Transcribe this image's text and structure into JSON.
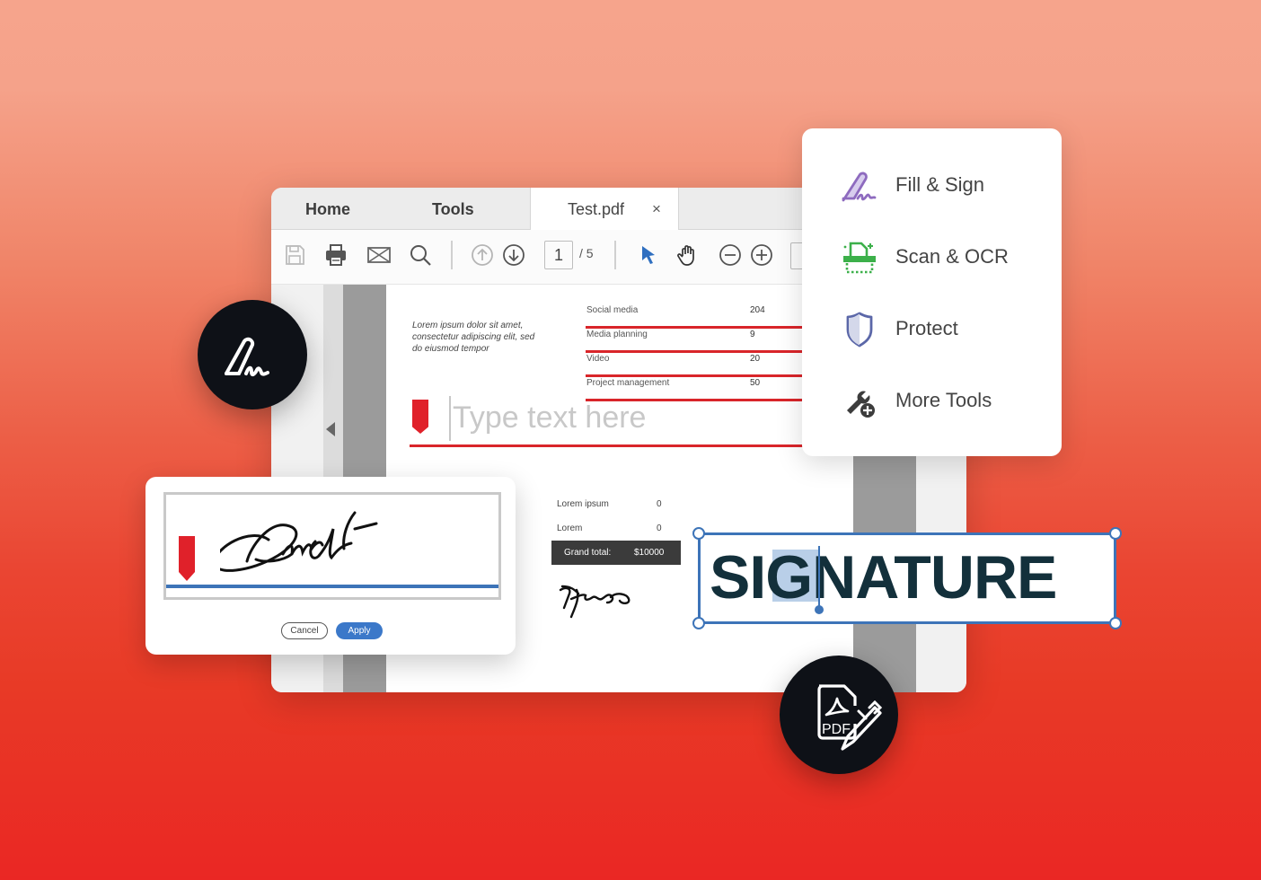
{
  "window": {
    "tabs": [
      {
        "label": "Home"
      },
      {
        "label": "Tools"
      },
      {
        "label": "Test.pdf",
        "close": "×"
      }
    ],
    "toolbar": {
      "icons": [
        "save-icon",
        "print-icon",
        "email-icon",
        "search-icon",
        "page-up-icon",
        "page-down-icon",
        "select-cursor-icon",
        "hand-icon",
        "zoom-out-icon",
        "zoom-in-icon"
      ],
      "page_current": "1",
      "page_total": "/ 5"
    }
  },
  "document": {
    "paragraph": "Lorem ipsum dolor sit amet, consectetur adipiscing elit, sed do eiusmod tempor",
    "table": [
      {
        "label": "Social media",
        "value": "204"
      },
      {
        "label": "Media planning",
        "value": "9"
      },
      {
        "label": "Video",
        "value": "20"
      },
      {
        "label": "Project management",
        "value": "50"
      }
    ],
    "text_field_placeholder": "Type text here",
    "summary": [
      {
        "label": "Lorem ipsum",
        "value": "0"
      },
      {
        "label": "Lorem",
        "value": "0"
      }
    ],
    "grand_total": {
      "label": "Grand total:",
      "value": "$10000"
    }
  },
  "tools_menu": {
    "items": [
      {
        "label": "Fill & Sign",
        "icon": "fill-sign-icon",
        "color": "#8e6bbf"
      },
      {
        "label": "Scan & OCR",
        "icon": "scan-ocr-icon",
        "color": "#3cb04a"
      },
      {
        "label": "Protect",
        "icon": "shield-icon",
        "color": "#5b67a8"
      },
      {
        "label": "More Tools",
        "icon": "wrench-plus-icon",
        "color": "#3c3c3c"
      }
    ]
  },
  "signature_dialog": {
    "cancel_label": "Cancel",
    "apply_label": "Apply"
  },
  "signature_text": {
    "text": "SIGNATURE",
    "selected": "IG"
  },
  "colors": {
    "accent_blue": "#3d74b8",
    "accent_red": "#d9252a",
    "dark_text": "#13303b"
  }
}
